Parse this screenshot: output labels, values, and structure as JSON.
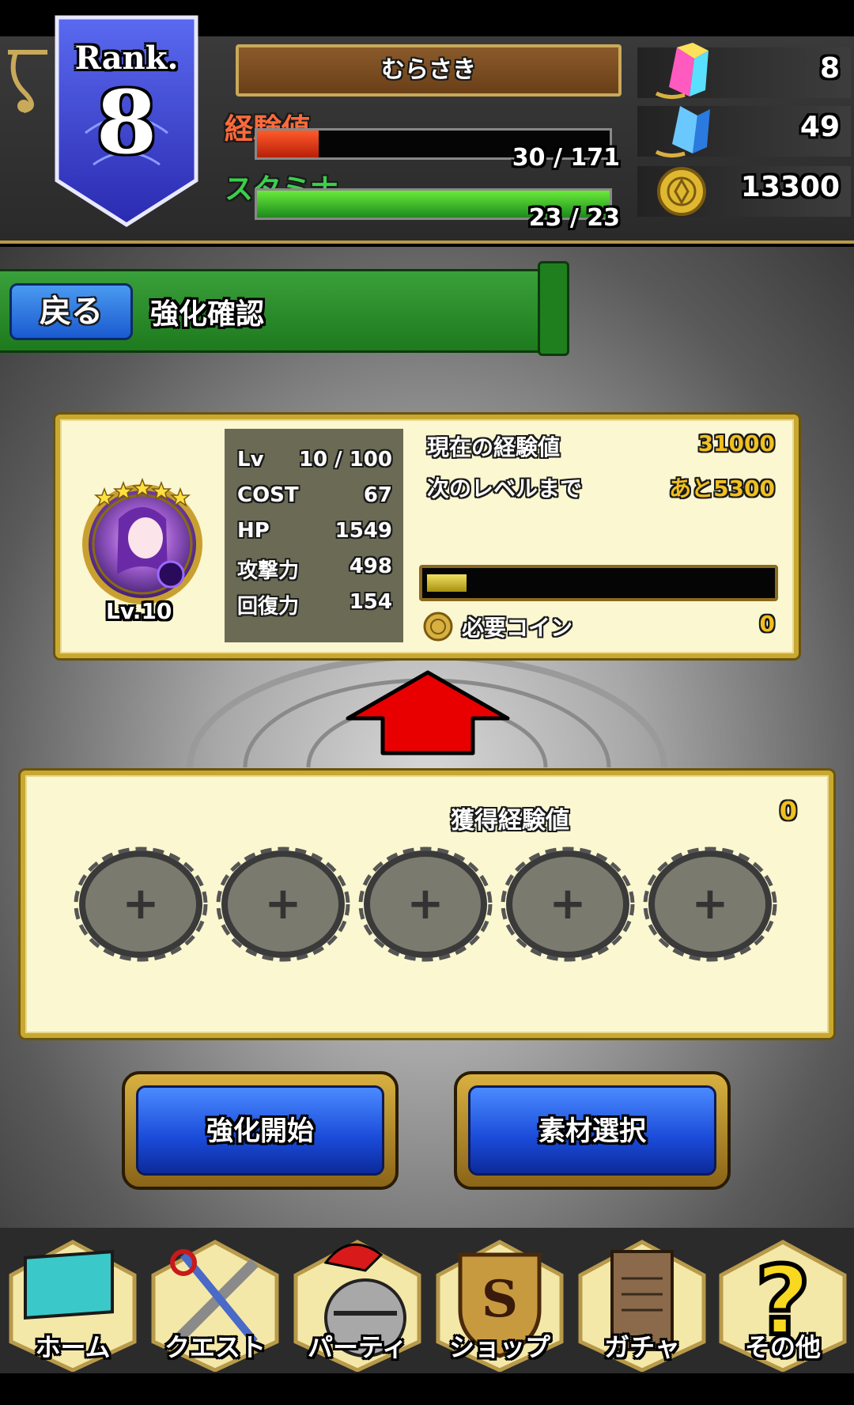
{
  "header": {
    "rank_label": "Rank.",
    "rank_value": "8",
    "player_name": "むらさき",
    "exp_label": "経験値",
    "exp_text": "30 / 171",
    "exp_ratio": 0.175,
    "stamina_label": "スタミナ",
    "stamina_text": "23 / 23",
    "stamina_ratio": 1.0,
    "resources": {
      "rainbow_crystals": "8",
      "blue_crystals": "49",
      "coins": "13300"
    }
  },
  "title_bar": {
    "back_label": "戻る",
    "page_title": "強化確認"
  },
  "character": {
    "portrait_level": "Lv.10",
    "stars": 5,
    "stats": [
      {
        "key": "Lv",
        "value": "10 / 100"
      },
      {
        "key": "COST",
        "value": "67"
      },
      {
        "key": "HP",
        "value": "1549"
      },
      {
        "key": "攻撃力",
        "value": "498"
      },
      {
        "key": "回復力",
        "value": "154"
      }
    ],
    "current_exp_label": "現在の経験値",
    "current_exp_value": "31000",
    "next_level_label": "次のレベルまで",
    "next_level_value": "あと5300",
    "level_progress": 0.14,
    "coin_required_label": "必要コイン",
    "coin_required_value": "0"
  },
  "materials": {
    "gain_label": "獲得経験値",
    "gain_value": "0",
    "slots": [
      "+",
      "+",
      "+",
      "+",
      "+"
    ]
  },
  "actions": {
    "start_label": "強化開始",
    "select_label": "素材選択"
  },
  "nav": [
    {
      "label": "ホーム",
      "icon": "flag-icon"
    },
    {
      "label": "クエスト",
      "icon": "swords-icon"
    },
    {
      "label": "パーティ",
      "icon": "helmet-icon"
    },
    {
      "label": "ショップ",
      "icon": "shop-shield-icon"
    },
    {
      "label": "ガチャ",
      "icon": "scroll-icon"
    },
    {
      "label": "その他",
      "icon": "question-icon"
    }
  ],
  "colors": {
    "exp_bar": "#e8441a",
    "stamina_bar": "#3ac03a",
    "ribbon_green": "#2a8f2a",
    "button_blue": "#1a4ad8",
    "gold_text": "#f0c020",
    "panel_cream": "#fbf7d0"
  }
}
